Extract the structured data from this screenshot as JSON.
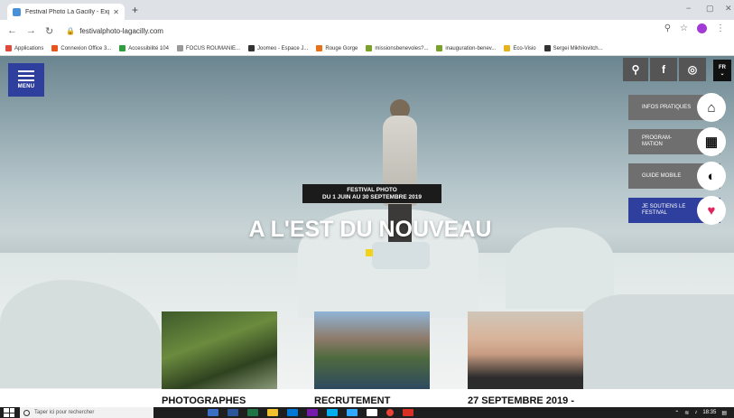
{
  "browser": {
    "tab_title": "Festival Photo La Gacilly - Expo P",
    "tab_close": "✕",
    "new_tab": "+",
    "url": "festivalphoto-lagacilly.com",
    "window_min": "−",
    "window_max": "▢",
    "window_close": "✕"
  },
  "bookmarks": [
    {
      "label": "Applications",
      "color": "#e04a3a"
    },
    {
      "label": "Connexion Office 3...",
      "color": "#e8541c"
    },
    {
      "label": "Accessibilité 104",
      "color": "#2e9e3e"
    },
    {
      "label": "FOCUS ROUMANIE...",
      "color": "#9a9a9a"
    },
    {
      "label": "Joomeo - Espace J...",
      "color": "#333333"
    },
    {
      "label": "Rouge Gorge",
      "color": "#e6731c"
    },
    {
      "label": "missionsbenevoles?...",
      "color": "#7aa22a"
    },
    {
      "label": "inauguration-benev...",
      "color": "#7aa22a"
    },
    {
      "label": "Eco-Visio",
      "color": "#e8b21c"
    },
    {
      "label": "Sergei Mikhilovitch...",
      "color": "#333333"
    }
  ],
  "site": {
    "menu_label": "MENU",
    "lang_label": "FR",
    "top_icons": [
      "search-icon",
      "facebook-icon",
      "instagram-icon"
    ],
    "side_buttons": [
      {
        "label": "INFOS PRATIQUES",
        "icon": "map-pin-icon"
      },
      {
        "label": "PROGRAM-MATION",
        "icon": "calendar-icon"
      },
      {
        "label": "GUIDE MOBILE",
        "icon": "mobile-guide-icon"
      },
      {
        "label": "JE SOUTIENS LE FESTIVAL",
        "icon": "heart-icon"
      }
    ],
    "festival_line1": "FESTIVAL PHOTO",
    "festival_line2": "DU 1 JUIN AU 30 SEPTEMBRE 2019",
    "main_title": "A L'EST DU NOUVEAU",
    "cards": [
      {
        "title": "PHOTOGRAPHES"
      },
      {
        "title": "RECRUTEMENT"
      },
      {
        "title": "27 SEPTEMBRE 2019 -"
      }
    ]
  },
  "taskbar": {
    "search_placeholder": "Taper ici pour rechercher",
    "time": "18:35"
  },
  "colors": {
    "brand_blue": "#2e3f9e",
    "accent_yellow": "#f2d21b"
  }
}
